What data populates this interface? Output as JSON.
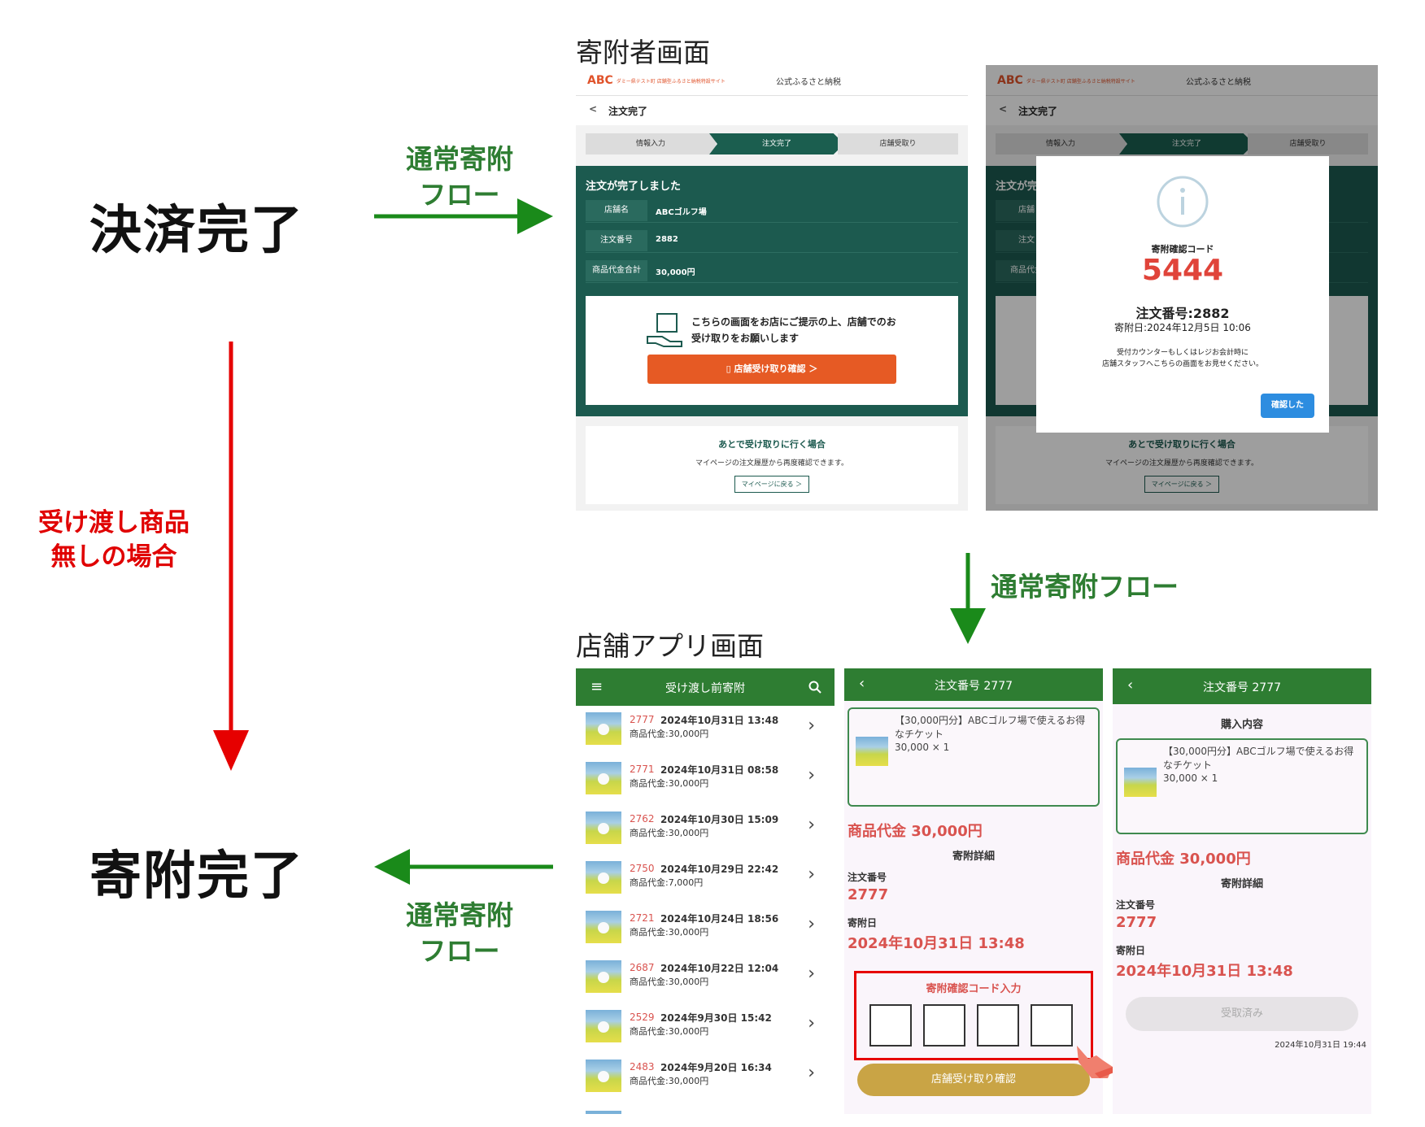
{
  "labels": {
    "payment_done": "決済完了",
    "donation_done": "寄附完了",
    "normal_flow_line1": "通常寄附",
    "normal_flow_line2": "フロー",
    "normal_flow_inline": "通常寄附フロー",
    "no_item_line1": "受け渡し商品",
    "no_item_line2": "無しの場合",
    "donor_screen": "寄附者画面",
    "store_app_screen": "店舗アプリ画面"
  },
  "colors": {
    "green_arrow": "#1a8a1a",
    "red_arrow": "#e60000",
    "panel_green": "#1c5a4f",
    "app_green": "#2e7d32",
    "orange": "#e65a24"
  },
  "donor": {
    "logo": "ABC",
    "logo_sub": "ダミー県テスト町 店舗型ふるさと納税特設サイト",
    "site_title": "公式ふるさと納税",
    "page_title": "注文完了",
    "back": "<",
    "steps": [
      "情報入力",
      "注文完了",
      "店舗受取り"
    ],
    "panel_title": "注文が完了しました",
    "panel_title_cut": "注文が完",
    "rows": [
      {
        "k": "店舗名",
        "v": "ABCゴルフ場"
      },
      {
        "k": "注文番号",
        "v": "2882"
      },
      {
        "k": "商品代金合計",
        "v": "30,000円"
      }
    ],
    "row_keys_cut": [
      "店舗",
      "注文",
      "商品代金"
    ],
    "notice": "こちらの画面をお店にご提示の上、店舗でのお受け取りをお願いします",
    "receive_button": "店舗受け取り確認 ＞",
    "later_title": "あとで受け取りに行く場合",
    "later_desc": "マイページの注文履歴から再度確認できます。",
    "later_button": "マイページに戻る ＞",
    "modal": {
      "code_label": "寄附確認コード",
      "code": "5444",
      "order": "注文番号:2882",
      "date": "寄附日:2024年12月5日 10:06",
      "desc1": "受付カウンターもしくはレジお会計時に",
      "desc2": "店舗スタッフへこちらの画面をお見せください。",
      "ok": "確認した"
    }
  },
  "app_list": {
    "title": "受け渡し前寄附",
    "items": [
      {
        "num": "2777",
        "dt": "2024年10月31日 13:48",
        "price": "商品代金:30,000円"
      },
      {
        "num": "2771",
        "dt": "2024年10月31日 08:58",
        "price": "商品代金:30,000円"
      },
      {
        "num": "2762",
        "dt": "2024年10月30日 15:09",
        "price": "商品代金:30,000円"
      },
      {
        "num": "2750",
        "dt": "2024年10月29日 22:42",
        "price": "商品代金:7,000円"
      },
      {
        "num": "2721",
        "dt": "2024年10月24日 18:56",
        "price": "商品代金:30,000円"
      },
      {
        "num": "2687",
        "dt": "2024年10月22日 12:04",
        "price": "商品代金:30,000円"
      },
      {
        "num": "2529",
        "dt": "2024年9月30日 15:42",
        "price": "商品代金:30,000円"
      },
      {
        "num": "2483",
        "dt": "2024年9月20日 16:34",
        "price": "商品代金:30,000円"
      }
    ]
  },
  "app_detail": {
    "title": "注文番号 2777",
    "item_name": "【30,000円分】ABCゴルフ場で使えるお得なチケット",
    "qty": "30,000 × 1",
    "price": "商品代金 30,000円",
    "detail_title": "寄附詳細",
    "order_label": "注文番号",
    "order": "2777",
    "date_label": "寄附日",
    "date": "2024年10月31日 13:48",
    "code_input_label": "寄附確認コード入力",
    "confirm_button": "店舗受け取り確認"
  },
  "app_done": {
    "title": "注文番号 2777",
    "purchase": "購入内容",
    "item_name": "【30,000円分】ABCゴルフ場で使えるお得なチケット",
    "qty": "30,000 × 1",
    "price": "商品代金 30,000円",
    "detail_title": "寄附詳細",
    "order_label": "注文番号",
    "order": "2777",
    "date_label": "寄附日",
    "date": "2024年10月31日 13:48",
    "received": "受取済み",
    "received_at": "2024年10月31日 19:44"
  }
}
